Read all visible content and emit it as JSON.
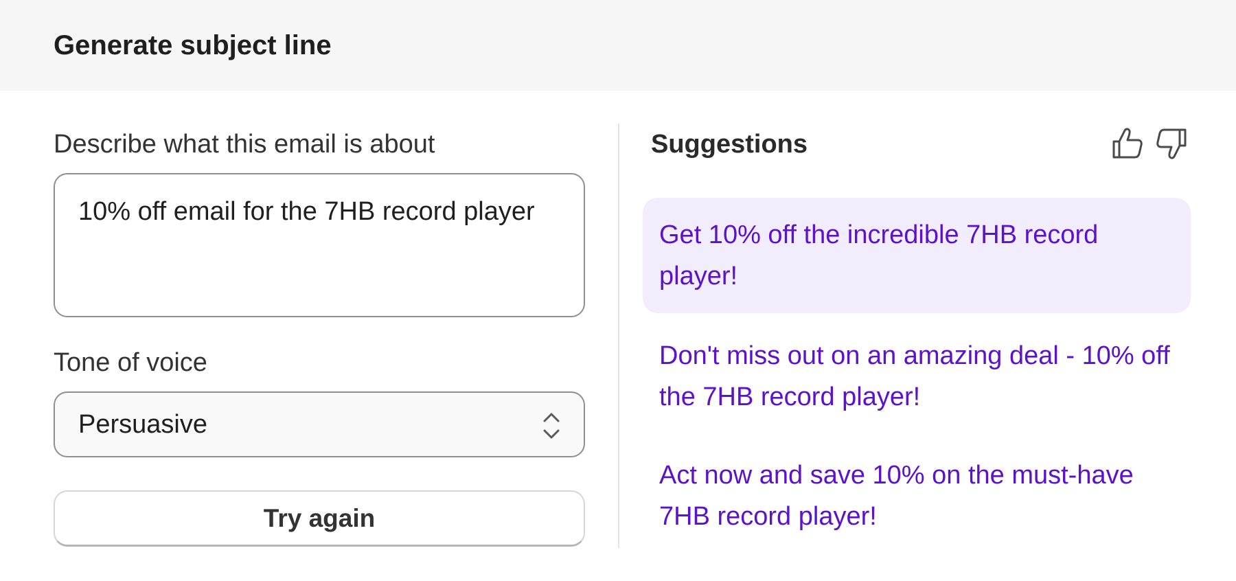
{
  "header": {
    "title": "Generate subject line"
  },
  "form": {
    "description_label": "Describe what this email is about",
    "description_value": "10% off email for the 7HB record player",
    "tone_label": "Tone of voice",
    "tone_value": "Persuasive",
    "try_again_label": "Try again"
  },
  "suggestions": {
    "title": "Suggestions",
    "feedback_icons": [
      "thumbs-up-icon",
      "thumbs-down-icon"
    ],
    "selected_index": 0,
    "items": [
      "Get 10% off the incredible 7HB record player!",
      "Don't miss out on an amazing deal - 10% off the 7HB record player!",
      "Act now and save 10% on the must-have 7HB record player!"
    ]
  },
  "colors": {
    "header_background": "#f6f6f6",
    "suggestion_text": "#5b12c9",
    "selected_suggestion_background": "#f1edfd"
  }
}
